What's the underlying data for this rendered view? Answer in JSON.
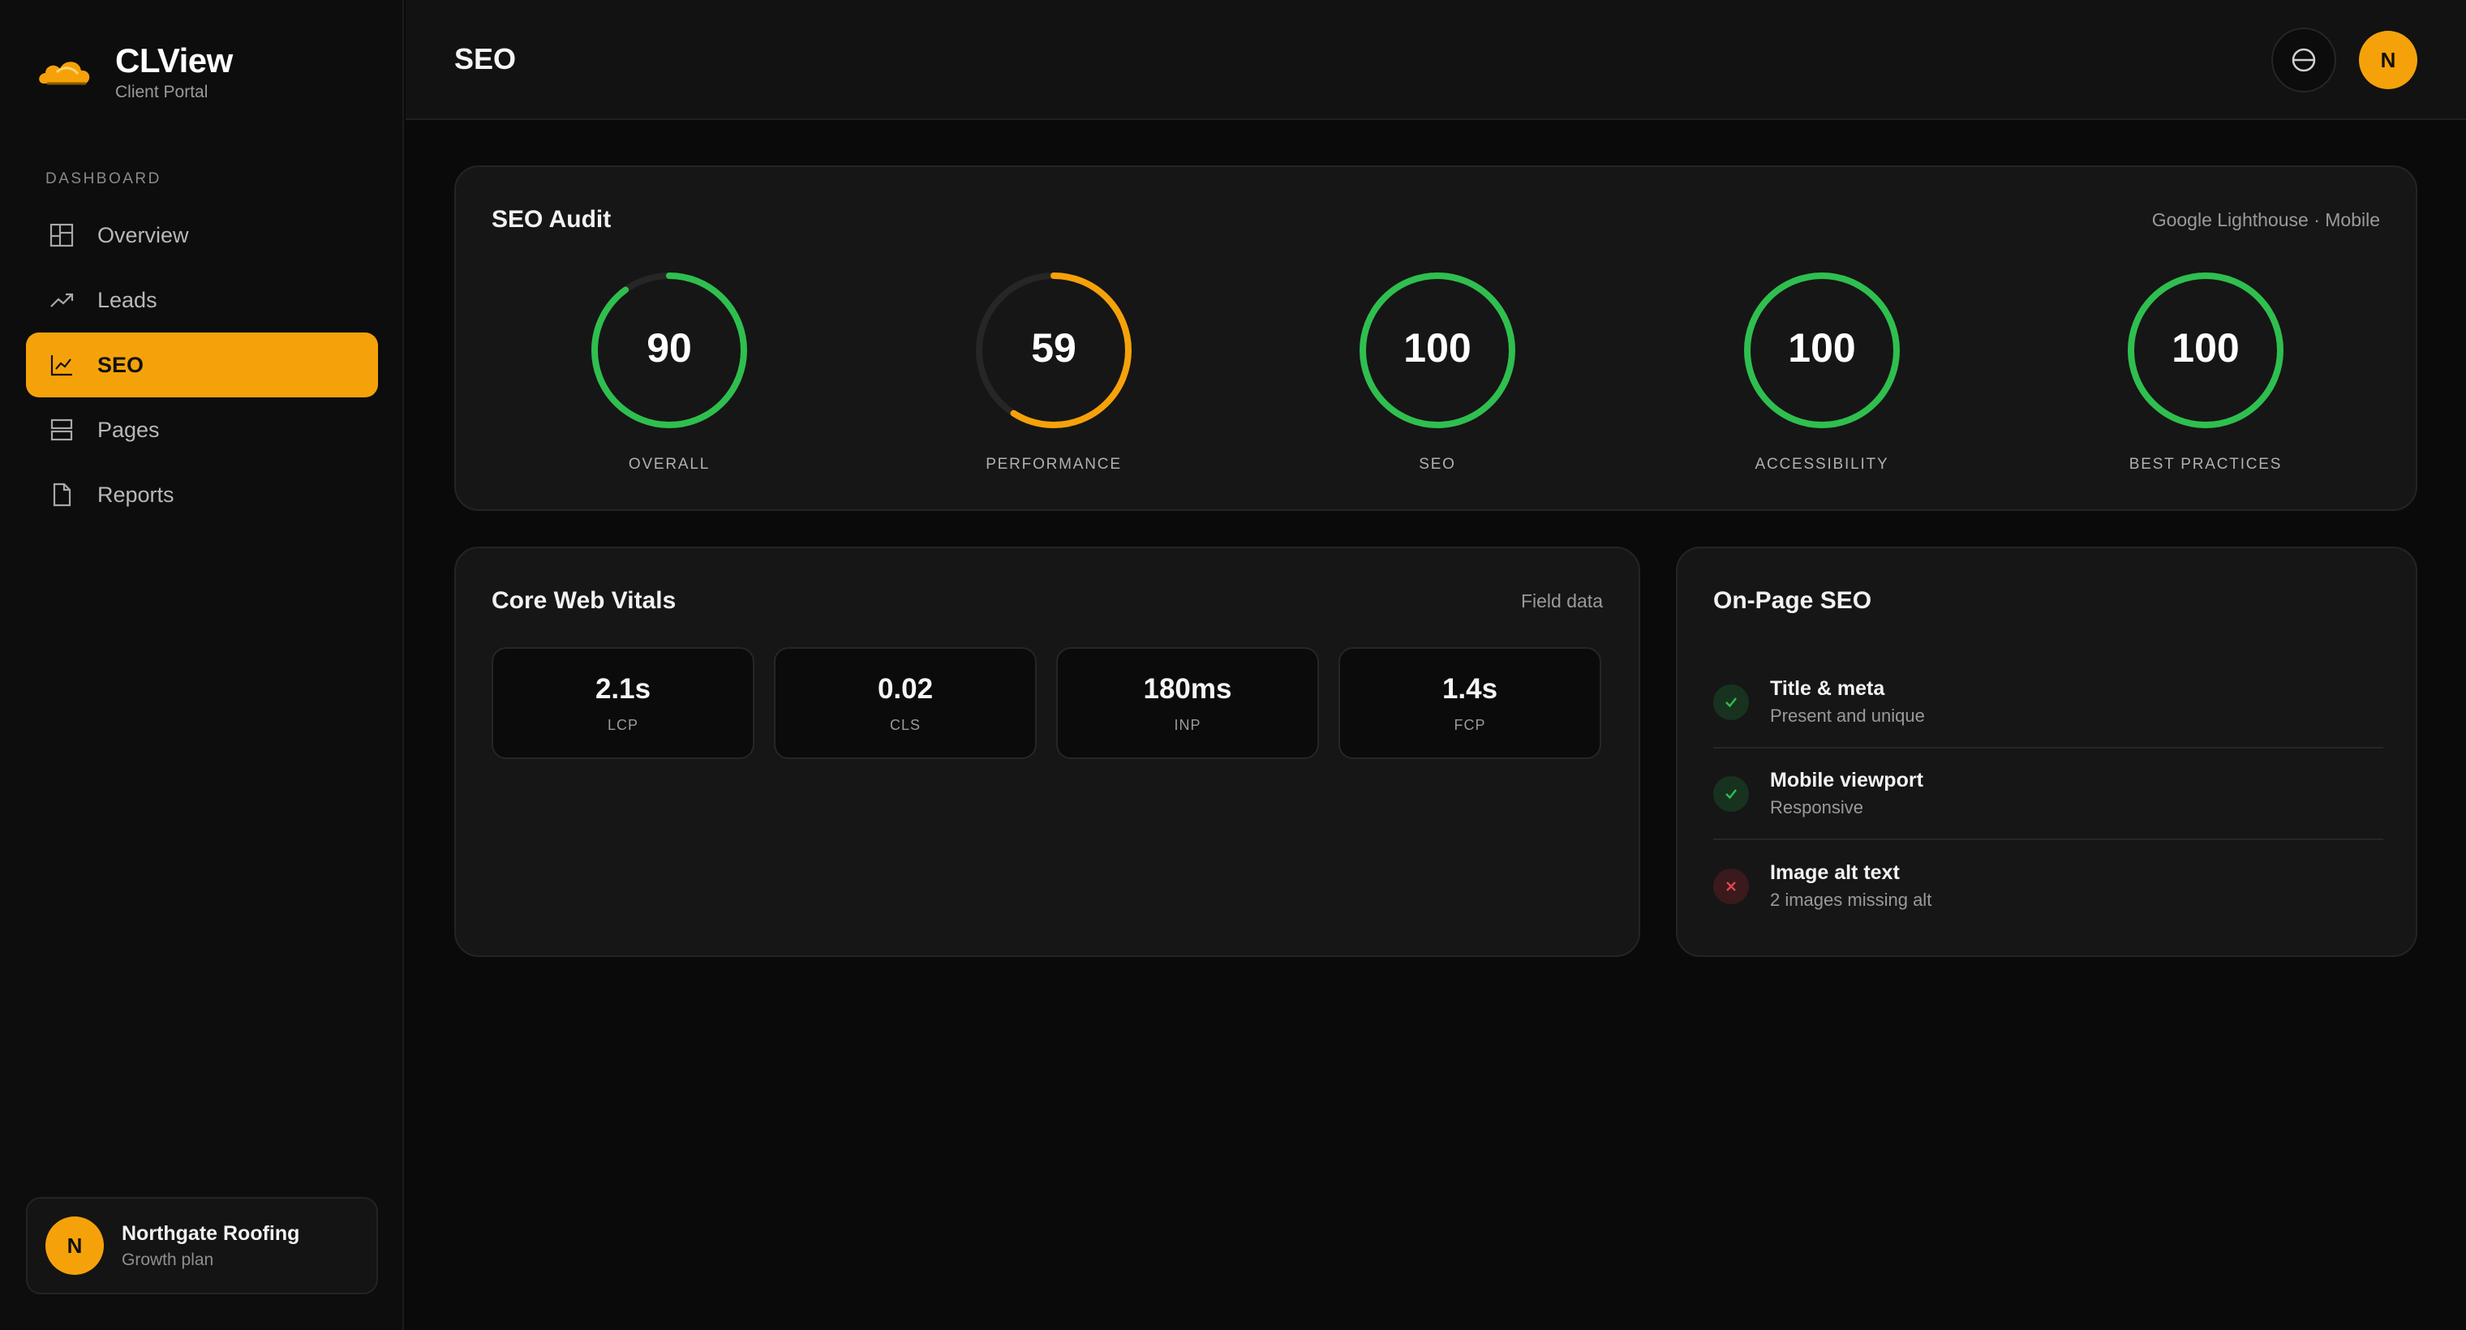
{
  "brand": {
    "title": "CLView",
    "subtitle": "Client Portal"
  },
  "sidebar": {
    "section_label": "DASHBOARD",
    "items": [
      {
        "label": "Overview",
        "icon": "layout-icon",
        "active": false
      },
      {
        "label": "Leads",
        "icon": "trending-up-icon",
        "active": false
      },
      {
        "label": "SEO",
        "icon": "line-chart-icon",
        "active": true
      },
      {
        "label": "Pages",
        "icon": "pages-icon",
        "active": false
      },
      {
        "label": "Reports",
        "icon": "file-icon",
        "active": false
      }
    ],
    "account": {
      "initial": "N",
      "name": "Northgate Roofing",
      "plan": "Growth plan"
    }
  },
  "header": {
    "title": "SEO",
    "avatar_initial": "N"
  },
  "audit": {
    "title": "SEO Audit",
    "meta": "Google Lighthouse · Mobile",
    "scores": [
      {
        "label": "OVERALL",
        "value": "90",
        "percent": 90,
        "color": "#2fbf4f"
      },
      {
        "label": "PERFORMANCE",
        "value": "59",
        "percent": 59,
        "color": "#f5a20a"
      },
      {
        "label": "SEO",
        "value": "100",
        "percent": 100,
        "color": "#2fbf4f"
      },
      {
        "label": "ACCESSIBILITY",
        "value": "100",
        "percent": 100,
        "color": "#2fbf4f"
      },
      {
        "label": "BEST PRACTICES",
        "value": "100",
        "percent": 100,
        "color": "#2fbf4f"
      }
    ]
  },
  "vitals": {
    "title": "Core Web Vitals",
    "meta": "Field data",
    "items": [
      {
        "value": "2.1s",
        "name": "LCP"
      },
      {
        "value": "0.02",
        "name": "CLS"
      },
      {
        "value": "180ms",
        "name": "INP"
      },
      {
        "value": "1.4s",
        "name": "FCP"
      }
    ]
  },
  "onpage": {
    "title": "On-Page SEO",
    "checks": [
      {
        "title": "Title & meta",
        "desc": "Present and unique",
        "status": "pass"
      },
      {
        "title": "Mobile viewport",
        "desc": "Responsive",
        "status": "pass"
      },
      {
        "title": "Image alt text",
        "desc": "2 images missing alt",
        "status": "fail"
      }
    ]
  },
  "colors": {
    "accent": "#f5a20a",
    "good": "#2fbf4f",
    "bad": "#e0474c",
    "track": "#2a2a2a"
  }
}
